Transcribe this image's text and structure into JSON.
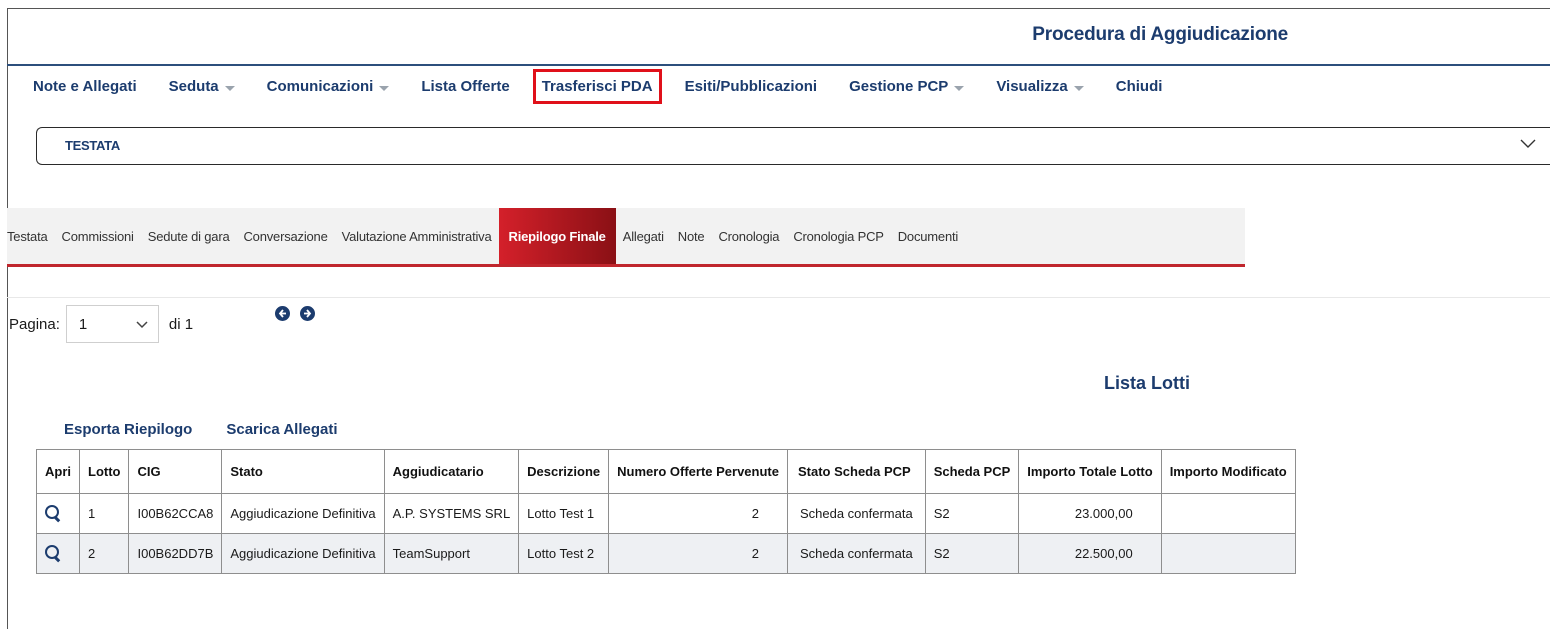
{
  "header": {
    "title": "Procedura di Aggiudicazione"
  },
  "menu": {
    "items": [
      {
        "label": "Note e Allegati",
        "dropdown": false
      },
      {
        "label": "Seduta",
        "dropdown": true
      },
      {
        "label": "Comunicazioni",
        "dropdown": true
      },
      {
        "label": "Lista Offerte",
        "dropdown": false
      },
      {
        "label": "Trasferisci PDA",
        "dropdown": false,
        "highlighted": true
      },
      {
        "label": "Esiti/Pubblicazioni",
        "dropdown": false
      },
      {
        "label": "Gestione PCP",
        "dropdown": true
      },
      {
        "label": "Visualizza",
        "dropdown": true
      },
      {
        "label": "Chiudi",
        "dropdown": false
      }
    ]
  },
  "testata_section": {
    "label": "TESTATA",
    "icon": "chevron-down-icon"
  },
  "tabs": {
    "items": [
      "Testata",
      "Commissioni",
      "Sedute di gara",
      "Conversazione",
      "Valutazione Amministrativa",
      "Riepilogo Finale",
      "Allegati",
      "Note",
      "Cronologia",
      "Cronologia PCP",
      "Documenti"
    ],
    "active": "Riepilogo Finale",
    "active_color": "#c0262d"
  },
  "pagination": {
    "label": "Pagina:",
    "current": "1",
    "of_text": "di 1",
    "prev_icon": "arrow-left-circle-icon",
    "next_icon": "arrow-right-circle-icon"
  },
  "lista": {
    "title": "Lista Lotti"
  },
  "actions": {
    "export": "Esporta Riepilogo",
    "download": "Scarica Allegati"
  },
  "table": {
    "columns": [
      "Apri",
      "Lotto",
      "CIG",
      "Stato",
      "Aggiudicatario",
      "Descrizione",
      "Numero Offerte Pervenute",
      "Stato Scheda PCP",
      "Scheda PCP",
      "Importo Totale Lotto",
      "Importo Modificato"
    ],
    "rows": [
      {
        "lotto": "1",
        "cig": "I00B62CCA8",
        "stato": "Aggiudicazione Definitiva",
        "aggiudicatario": "A.P. SYSTEMS SRL",
        "descrizione": "Lotto Test 1",
        "numero_offerte": "2",
        "stato_scheda": "Scheda confermata",
        "scheda_pcp": "S2",
        "importo_totale": "23.000,00",
        "importo_modificato": ""
      },
      {
        "lotto": "2",
        "cig": "I00B62DD7B",
        "stato": "Aggiudicazione Definitiva",
        "aggiudicatario": "TeamSupport",
        "descrizione": "Lotto Test 2",
        "numero_offerte": "2",
        "stato_scheda": "Scheda confermata",
        "scheda_pcp": "S2",
        "importo_totale": "22.500,00",
        "importo_modificato": ""
      }
    ]
  },
  "colors": {
    "brand_blue": "#1c3c6e",
    "highlight_red": "#e0101a"
  }
}
